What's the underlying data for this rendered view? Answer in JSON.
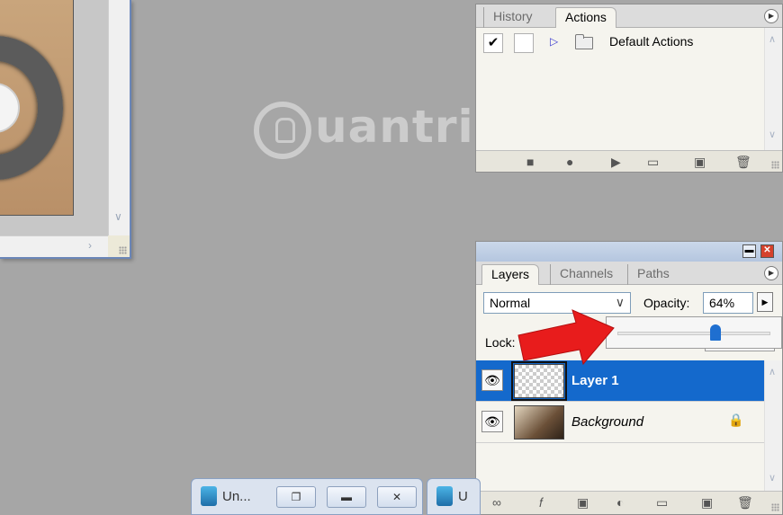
{
  "watermark": {
    "text": "uantrimang"
  },
  "actions_panel": {
    "tabs": [
      {
        "label": "History",
        "active": false
      },
      {
        "label": "Actions",
        "active": true
      }
    ],
    "rows": [
      {
        "checked": "✔",
        "label": "Default Actions"
      }
    ]
  },
  "layers_panel": {
    "tabs": [
      {
        "label": "Layers",
        "active": true
      },
      {
        "label": "Channels",
        "active": false
      },
      {
        "label": "Paths",
        "active": false
      }
    ],
    "blend_mode": "Normal",
    "opacity_label": "Opacity:",
    "opacity_value": "64%",
    "opacity_slider_fraction": 0.64,
    "lock_label": "Lock:",
    "layers": [
      {
        "name": "Layer 1",
        "selected": true,
        "visible": true
      },
      {
        "name": "Background",
        "selected": false,
        "visible": true,
        "locked": true
      }
    ]
  },
  "minimized_windows": [
    {
      "title": "Un..."
    },
    {
      "title": "U"
    }
  ],
  "colors": {
    "workspace": "#a6a6a6",
    "selection": "#1469cc",
    "arrow_red": "#e81c1c",
    "slider_thumb": "#1f6fd0"
  }
}
